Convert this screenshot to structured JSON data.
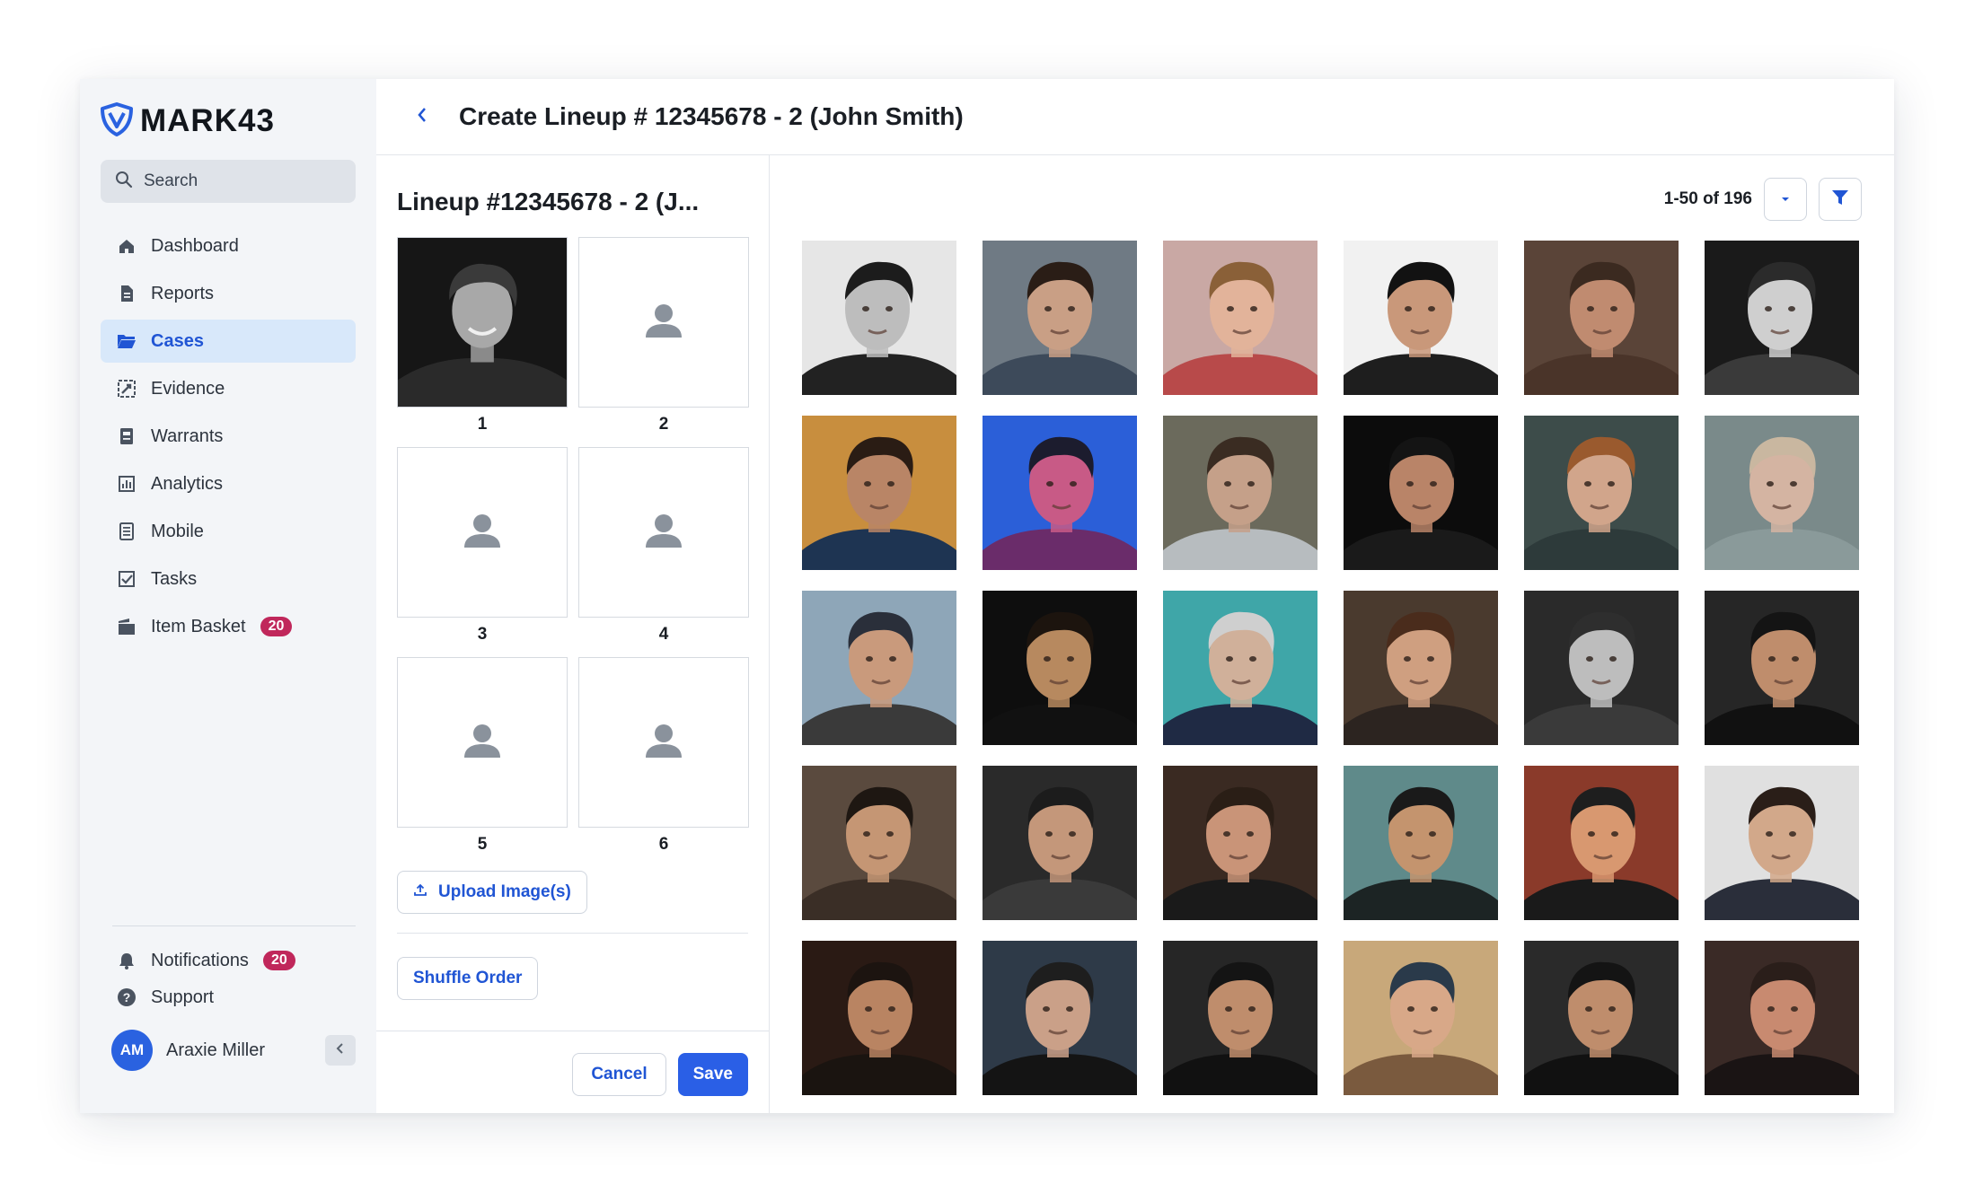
{
  "app": {
    "brand": "MARK43",
    "brand_color": "#2a62e0",
    "accent_color": "#2055d4",
    "badge_color": "#c0275b"
  },
  "sidebar": {
    "search_placeholder": "Search",
    "items": [
      {
        "label": "Dashboard",
        "icon": "home-icon"
      },
      {
        "label": "Reports",
        "icon": "document-icon"
      },
      {
        "label": "Cases",
        "icon": "folder-icon",
        "active": true
      },
      {
        "label": "Evidence",
        "icon": "evidence-icon"
      },
      {
        "label": "Warrants",
        "icon": "warrant-icon"
      },
      {
        "label": "Analytics",
        "icon": "chart-icon"
      },
      {
        "label": "Mobile",
        "icon": "mobile-icon"
      },
      {
        "label": "Tasks",
        "icon": "checkbox-icon"
      },
      {
        "label": "Item Basket",
        "icon": "basket-icon",
        "badge": "20"
      }
    ],
    "notifications": {
      "label": "Notifications",
      "badge": "20"
    },
    "support": {
      "label": "Support"
    },
    "user": {
      "initials": "AM",
      "name": "Araxie Miller"
    }
  },
  "header": {
    "title": "Create Lineup # 12345678 - 2 (John Smith)"
  },
  "lineup": {
    "title": "Lineup #12345678 - 2 (J...",
    "slots": [
      {
        "number": "1",
        "filled": true
      },
      {
        "number": "2",
        "filled": false
      },
      {
        "number": "3",
        "filled": false
      },
      {
        "number": "4",
        "filled": false
      },
      {
        "number": "5",
        "filled": false
      },
      {
        "number": "6",
        "filled": false
      }
    ],
    "upload_label": "Upload Image(s)",
    "shuffle_label": "Shuffle Order",
    "cancel_label": "Cancel",
    "save_label": "Save"
  },
  "gallery": {
    "pager_text": "1-50 of 196",
    "photos": [
      {
        "bg": "#e6e6e6",
        "skin": "#bdbdbd",
        "hair": "#1c1c1c",
        "shirt": "#222222"
      },
      {
        "bg": "#6f7a84",
        "skin": "#c99f85",
        "hair": "#2a1d16",
        "shirt": "#3d4a5a"
      },
      {
        "bg": "#c9a8a4",
        "skin": "#e2b39a",
        "hair": "#8a6038",
        "shirt": "#b84a4a"
      },
      {
        "bg": "#f1f1f1",
        "skin": "#c9987a",
        "hair": "#121212",
        "shirt": "#1e1e1e"
      },
      {
        "bg": "#5a4438",
        "skin": "#c08b70",
        "hair": "#3b2a20",
        "shirt": "#4a3429"
      },
      {
        "bg": "#1a1a1a",
        "skin": "#cfcfcf",
        "hair": "#2b2b2b",
        "shirt": "#3a3a3a"
      },
      {
        "bg": "#c88e3e",
        "skin": "#b98566",
        "hair": "#2a1c14",
        "shirt": "#1e3452"
      },
      {
        "bg": "#2b5fd8",
        "skin": "#c85a86",
        "hair": "#1c1c2e",
        "shirt": "#6a2c6a"
      },
      {
        "bg": "#6b6a5c",
        "skin": "#c5a089",
        "hair": "#3a2c22",
        "shirt": "#b7bcbf"
      },
      {
        "bg": "#0c0c0c",
        "skin": "#b98468",
        "hair": "#141414",
        "shirt": "#1a1a1a"
      },
      {
        "bg": "#3d4c4a",
        "skin": "#d1a58b",
        "hair": "#9a5a2e",
        "shirt": "#2d3a3a"
      },
      {
        "bg": "#7a8a8a",
        "skin": "#d4b4a2",
        "hair": "#c9b7a0",
        "shirt": "#8a9a9a"
      },
      {
        "bg": "#8ea6b8",
        "skin": "#c99a7c",
        "hair": "#2a2f3a",
        "shirt": "#3a3a3a"
      },
      {
        "bg": "#0e0e0e",
        "skin": "#b7895f",
        "hair": "#1c140e",
        "shirt": "#111111"
      },
      {
        "bg": "#3fa6a8",
        "skin": "#d0b09a",
        "hair": "#cfcfcf",
        "shirt": "#1f2a44"
      },
      {
        "bg": "#4a3a2e",
        "skin": "#cf9f80",
        "hair": "#4a2c1c",
        "shirt": "#2c2420"
      },
      {
        "bg": "#2a2a2a",
        "skin": "#bdbdbd",
        "hair": "#2e2e2e",
        "shirt": "#3a3a3a"
      },
      {
        "bg": "#262626",
        "skin": "#bf8d6c",
        "hair": "#141414",
        "shirt": "#111111"
      },
      {
        "bg": "#5a4a3e",
        "skin": "#c59674",
        "hair": "#1e1712",
        "shirt": "#3a2e26"
      },
      {
        "bg": "#2a2a2a",
        "skin": "#c4977a",
        "hair": "#1c1c1c",
        "shirt": "#3a3a3a"
      },
      {
        "bg": "#3a2a22",
        "skin": "#c99478",
        "hair": "#2a1e16",
        "shirt": "#1a1a1a"
      },
      {
        "bg": "#5f8a8a",
        "skin": "#c4946e",
        "hair": "#1a1a1a",
        "shirt": "#1c2424"
      },
      {
        "bg": "#8a3a2a",
        "skin": "#d89870",
        "hair": "#1e1e1e",
        "shirt": "#1a1a1a"
      },
      {
        "bg": "#e0e0e0",
        "skin": "#d2a88a",
        "hair": "#2a1e18",
        "shirt": "#2a2e3a"
      },
      {
        "bg": "#2a1a14",
        "skin": "#b98462",
        "hair": "#1c1410",
        "shirt": "#1a1410"
      },
      {
        "bg": "#2e3a48",
        "skin": "#caa088",
        "hair": "#1e1e1e",
        "shirt": "#141414"
      },
      {
        "bg": "#262626",
        "skin": "#bf8d6c",
        "hair": "#141414",
        "shirt": "#111111"
      },
      {
        "bg": "#c8a87a",
        "skin": "#d8a888",
        "hair": "#2a3a4a",
        "shirt": "#7a5a3e"
      },
      {
        "bg": "#2a2a2a",
        "skin": "#bf8d6c",
        "hair": "#141414",
        "shirt": "#111111"
      },
      {
        "bg": "#3a2a26",
        "skin": "#c88a70",
        "hair": "#2a1e1a",
        "shirt": "#1a1414"
      }
    ]
  }
}
